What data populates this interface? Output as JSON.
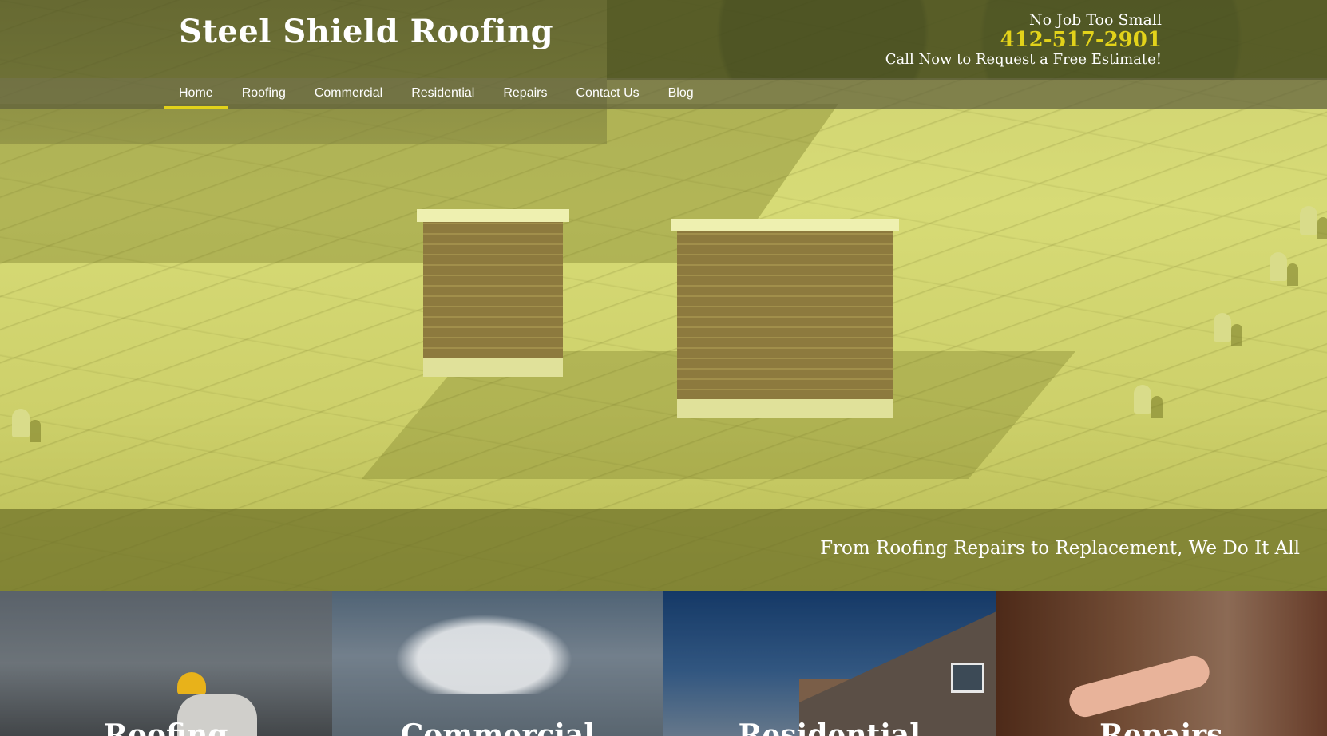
{
  "header": {
    "site_title": "Steel Shield Roofing",
    "tagline": "No Job Too Small",
    "phone": "412-517-2901",
    "cta": "Call Now to Request a Free Estimate!",
    "accent_color": "#e2d21a"
  },
  "nav": {
    "items": [
      {
        "label": "Home",
        "active": true
      },
      {
        "label": "Roofing",
        "active": false
      },
      {
        "label": "Commercial",
        "active": false
      },
      {
        "label": "Residential",
        "active": false
      },
      {
        "label": "Repairs",
        "active": false
      },
      {
        "label": "Contact Us",
        "active": false
      },
      {
        "label": "Blog",
        "active": false
      }
    ]
  },
  "hero": {
    "slogan": "From Roofing Repairs to Replacement, We Do It All"
  },
  "tiles": [
    {
      "label": "Roofing"
    },
    {
      "label": "Commercial"
    },
    {
      "label": "Residential"
    },
    {
      "label": "Repairs"
    }
  ]
}
